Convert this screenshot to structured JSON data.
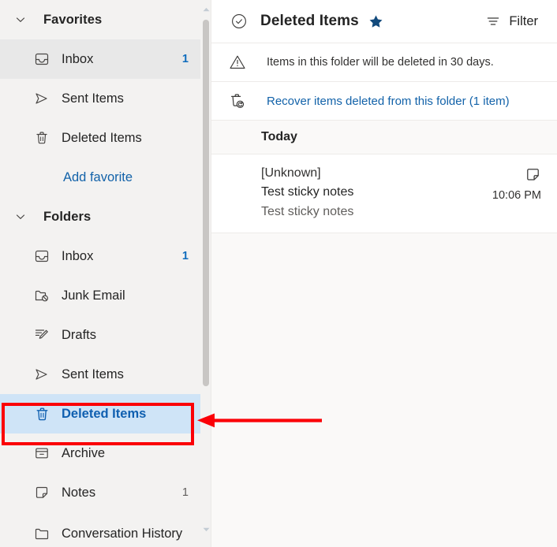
{
  "sidebar": {
    "sections": [
      {
        "id": "favorites",
        "title": "Favorites",
        "chevron_icon": "chevron-down-icon",
        "items": [
          {
            "label": "Inbox",
            "icon": "inbox-icon",
            "count": "1",
            "state": "hover"
          },
          {
            "label": "Sent Items",
            "icon": "send-icon",
            "count": "",
            "state": "normal"
          },
          {
            "label": "Deleted Items",
            "icon": "trash-icon",
            "count": "",
            "state": "normal"
          }
        ],
        "action_label": "Add favorite"
      },
      {
        "id": "folders",
        "title": "Folders",
        "chevron_icon": "chevron-down-icon",
        "items": [
          {
            "label": "Inbox",
            "icon": "inbox-icon",
            "count": "1",
            "state": "normal"
          },
          {
            "label": "Junk Email",
            "icon": "junk-folder-icon",
            "count": "",
            "state": "normal"
          },
          {
            "label": "Drafts",
            "icon": "drafts-pencil-icon",
            "count": "",
            "state": "normal"
          },
          {
            "label": "Sent Items",
            "icon": "send-icon",
            "count": "",
            "state": "normal"
          },
          {
            "label": "Deleted Items",
            "icon": "trash-icon",
            "count": "",
            "state": "selected"
          },
          {
            "label": "Archive",
            "icon": "archive-box-icon",
            "count": "",
            "state": "normal"
          },
          {
            "label": "Notes",
            "icon": "note-icon",
            "count": "1",
            "state": "normal"
          },
          {
            "label": "Conversation History",
            "icon": "folder-icon",
            "count": "",
            "state": "cutoff"
          }
        ]
      }
    ],
    "scrollbar": {
      "up_arrow_icon": "scroll-up-arrow-icon",
      "down_arrow_icon": "scroll-down-arrow-icon"
    }
  },
  "header": {
    "select_icon": "circle-check-icon",
    "title": "Deleted Items",
    "star_icon": "star-filled-icon",
    "filter_icon": "filter-icon",
    "filter_label": "Filter"
  },
  "banners": [
    {
      "icon": "warning-triangle-icon",
      "text": "Items in this folder will be deleted in 30 days.",
      "type": "text"
    },
    {
      "icon": "restore-trash-icon",
      "text": "Recover items deleted from this folder (1 item)",
      "type": "link"
    }
  ],
  "message_list": {
    "day_group": "Today",
    "messages": [
      {
        "sender": "[Unknown]",
        "subject": "Test sticky notes",
        "preview": "Test sticky notes",
        "time": "10:06 PM",
        "badge_icon": "sticky-note-icon"
      }
    ]
  },
  "annotations": {
    "highlight_target": "Deleted Items",
    "color": "#fb0007"
  },
  "colors": {
    "sidebar_bg": "#f3f2f1",
    "selected_bg": "#cfe4f7",
    "selected_fg": "#0f5fb0",
    "link": "#1262a9",
    "accent_count": "#0f6cbd",
    "annotation_red": "#fb0007"
  }
}
